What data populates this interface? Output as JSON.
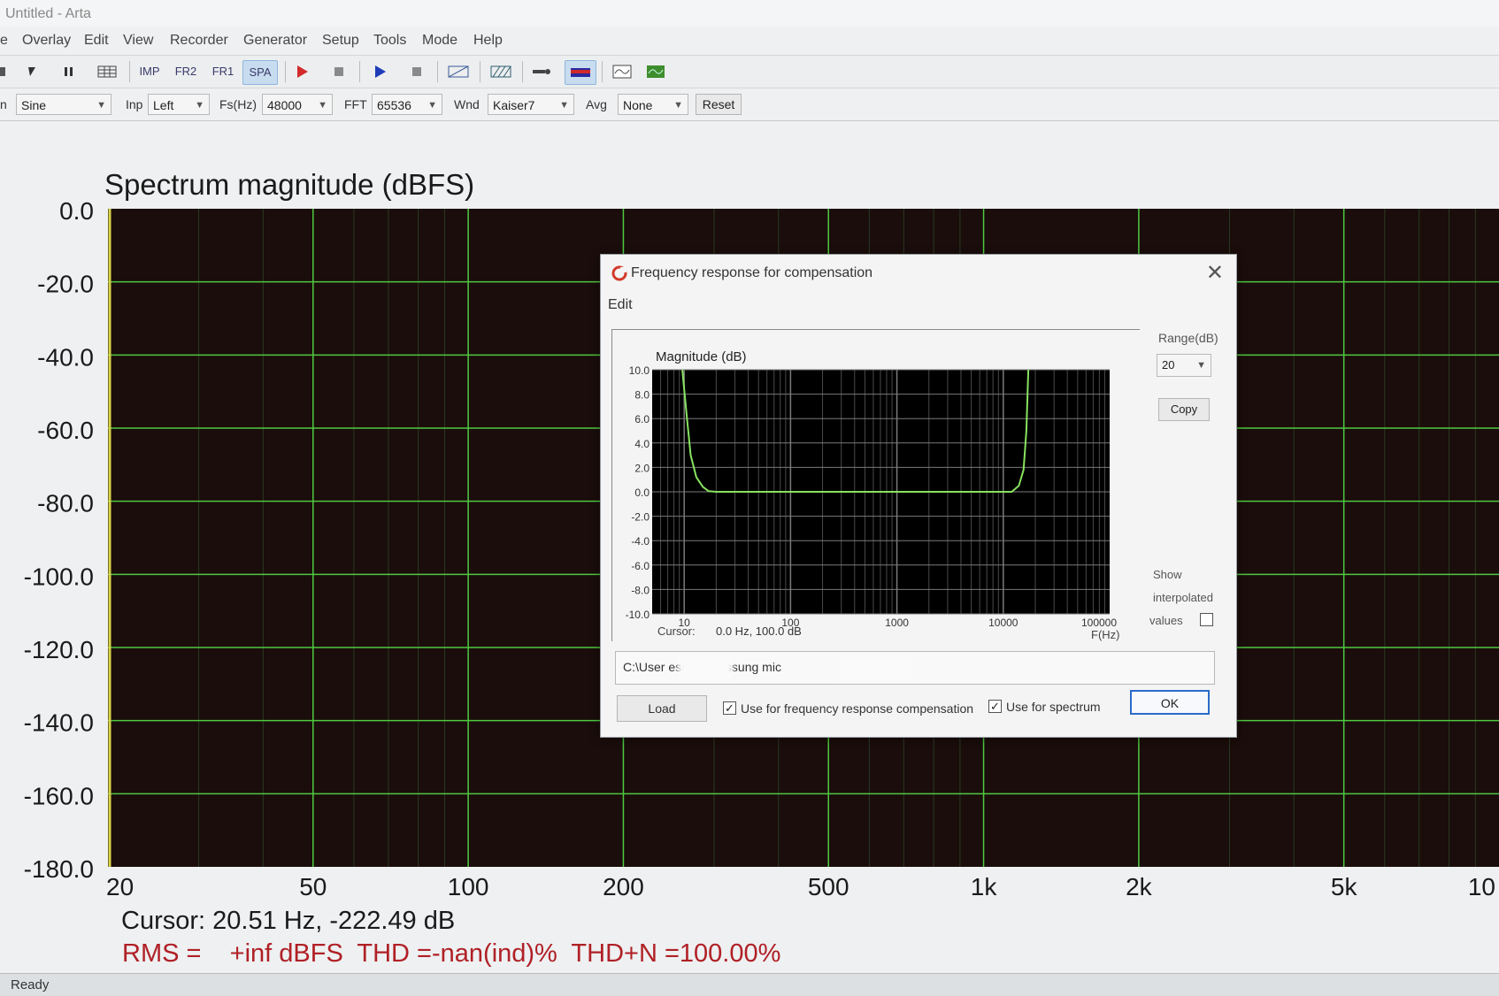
{
  "window": {
    "title": "Untitled - Arta"
  },
  "menu": [
    "e",
    "Overlay",
    "Edit",
    "View",
    "Recorder",
    "Generator",
    "Setup",
    "Tools",
    "Mode",
    "Help"
  ],
  "toolbar": {
    "imp": "IMP",
    "fr2": "FR2",
    "fr1": "FR1",
    "spa": "SPA",
    "active_mode": "SPA",
    "icons": [
      "new-icon",
      "pointer-icon",
      "pause-icon",
      "table-icon",
      "record-icon",
      "stop-icon",
      "play-icon",
      "stop2-icon",
      "abc-icon",
      "hatch-icon",
      "probe-icon",
      "colormap-icon",
      "scope-icon",
      "analyzer-icon"
    ]
  },
  "params": {
    "gen_prefix": "n",
    "gen": "Sine",
    "inp_label": "Inp",
    "inp": "Left",
    "fs_label": "Fs(Hz)",
    "fs": "48000",
    "fft_label": "FFT",
    "fft": "65536",
    "wnd_label": "Wnd",
    "wnd": "Kaiser7",
    "avg_label": "Avg",
    "avg": "None",
    "reset": "Reset"
  },
  "main_chart": {
    "title": "Spectrum magnitude (dBFS)",
    "y_ticks": [
      "0.0",
      "-20.0",
      "-40.0",
      "-60.0",
      "-80.0",
      "-100.0",
      "-120.0",
      "-140.0",
      "-160.0",
      "-180.0"
    ],
    "x_ticks": [
      "20",
      "50",
      "100",
      "200",
      "500",
      "1k",
      "2k",
      "5k",
      "10"
    ],
    "cursor_text": "Cursor: 20.51 Hz, -222.49 dB",
    "stats_text": "RMS =    +inf dBFS  THD =-nan(ind)%  THD+N =100.00%",
    "colors": {
      "background": "#1a0d0b",
      "grid": "#4fc940",
      "axis": "#d8d24a",
      "stats": "#b02026"
    }
  },
  "dialog": {
    "title": "Frequency response for compensation",
    "menu_edit": "Edit",
    "range_label": "Range(dB)",
    "range_value": "20",
    "copy": "Copy",
    "show_label": "Show",
    "interpolated_label": "interpolated",
    "values_label": "values",
    "show_interpolated_checked": false,
    "path": "C:\\User                   esktop\\Messung                     mic",
    "load": "Load",
    "use_freq_comp": "Use for frequency response compensation",
    "use_freq_comp_checked": true,
    "use_spectrum": "Use for spectrum",
    "use_spectrum_checked": true,
    "ok": "OK"
  },
  "chart_data": {
    "type": "line",
    "title": "Magnitude (dB)",
    "xlabel": "F(Hz)",
    "ylabel": "",
    "x_scale": "log",
    "xlim": [
      5,
      100000
    ],
    "ylim": [
      -10,
      10
    ],
    "x_ticks": [
      "10",
      "100",
      "1000",
      "10000",
      "100000"
    ],
    "y_ticks": [
      "10.0",
      "8.0",
      "6.0",
      "4.0",
      "2.0",
      "0.0",
      "-2.0",
      "-4.0",
      "-6.0",
      "-8.0",
      "-10.0"
    ],
    "cursor_label": "Cursor:",
    "cursor_value": "0.0 Hz, 100.0 dB",
    "grid": true,
    "series": [
      {
        "color": "#88e35f",
        "x": [
          9.6,
          10.5,
          11.5,
          13,
          15,
          17,
          20,
          50,
          200,
          1000,
          5000,
          12000,
          14000,
          15500,
          16500,
          17200
        ],
        "y": [
          10,
          6.5,
          3,
          1.2,
          0.4,
          0.05,
          0,
          0,
          0,
          0,
          0,
          0,
          0.5,
          1.8,
          5,
          10
        ]
      }
    ]
  }
}
